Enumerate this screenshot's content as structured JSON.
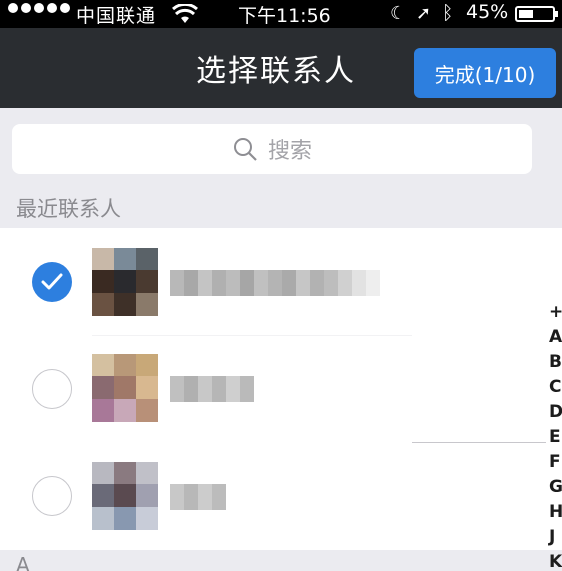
{
  "status_bar": {
    "carrier": "中国联通",
    "time": "下午11:56",
    "battery": "45%"
  },
  "nav": {
    "title": "选择联系人",
    "done_label": "完成(1/10)"
  },
  "search": {
    "placeholder": "搜索"
  },
  "sections": {
    "recent": "最近联系人",
    "a": "A"
  },
  "contacts": [
    {
      "checked": true
    },
    {
      "checked": false
    },
    {
      "checked": false
    }
  ],
  "index": [
    "+",
    "A",
    "B",
    "C",
    "D",
    "E",
    "F",
    "G",
    "H",
    "J",
    "K"
  ],
  "colors": {
    "accent": "#2d7fdf",
    "nav_bg": "#2a2d31",
    "section_bg": "#ebebf0"
  },
  "icons": {
    "search": "search-icon",
    "check": "checkmark-icon",
    "wifi": "wifi-icon",
    "location": "location-arrow-icon",
    "bluetooth": "bluetooth-icon",
    "moon": "moon-icon"
  }
}
